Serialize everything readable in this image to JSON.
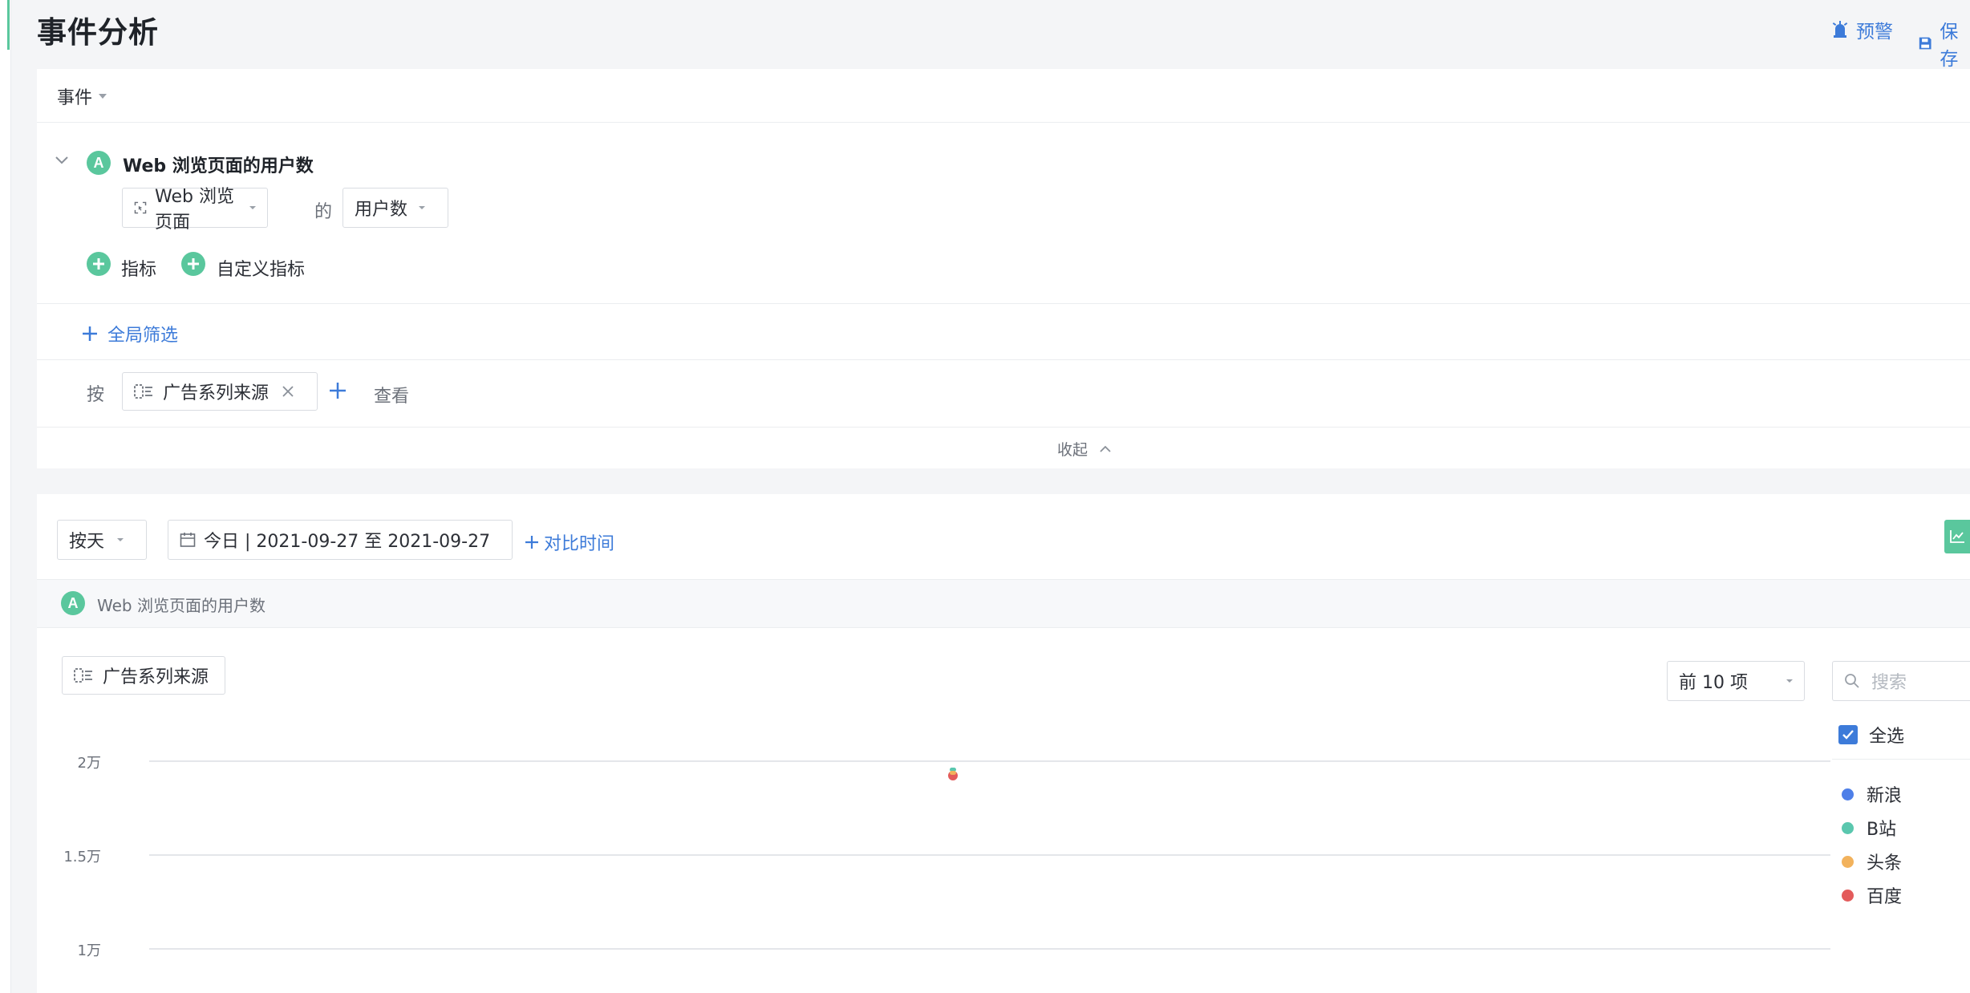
{
  "header": {
    "title": "事件分析",
    "alert_label": "预警",
    "save_label": "保存"
  },
  "query": {
    "type_dropdown": "事件",
    "metric": {
      "badge": "A",
      "title": "Web 浏览页面的用户数",
      "event": "Web 浏览页面",
      "of_word": "的",
      "measure": "用户数"
    },
    "add_metric_label": "指标",
    "add_custom_metric_label": "自定义指标",
    "global_filter_label": "全局筛选",
    "group_by_prefix": "按",
    "group_by_dimension": "广告系列来源",
    "group_by_suffix": "查看",
    "collapse_label": "收起"
  },
  "toolbar": {
    "granularity": "按天",
    "date_range": "今日 | 2021-09-27 至 2021-09-27",
    "compare_label": "对比时间"
  },
  "result": {
    "metric_badge": "A",
    "metric_title": "Web 浏览页面的用户数",
    "dimension_button": "广告系列来源",
    "topn": "前 10 项",
    "search_placeholder": "搜索",
    "select_all_label": "全选",
    "select_all_checked": true
  },
  "colors": {
    "accent": "#5ac79d",
    "link": "#3d7bd9"
  },
  "chart_data": {
    "type": "scatter",
    "y_ticks": [
      "2万",
      "1.5万",
      "1万"
    ],
    "y_tick_values": [
      20000,
      15000,
      10000
    ],
    "series": [
      {
        "name": "新浪",
        "color": "#4e7fe8"
      },
      {
        "name": "B站",
        "color": "#5ac7ae"
      },
      {
        "name": "头条",
        "color": "#f2b25c"
      },
      {
        "name": "百度",
        "color": "#e35b5b",
        "values": [
          19250
        ]
      }
    ],
    "grid": true,
    "legend": "right"
  }
}
